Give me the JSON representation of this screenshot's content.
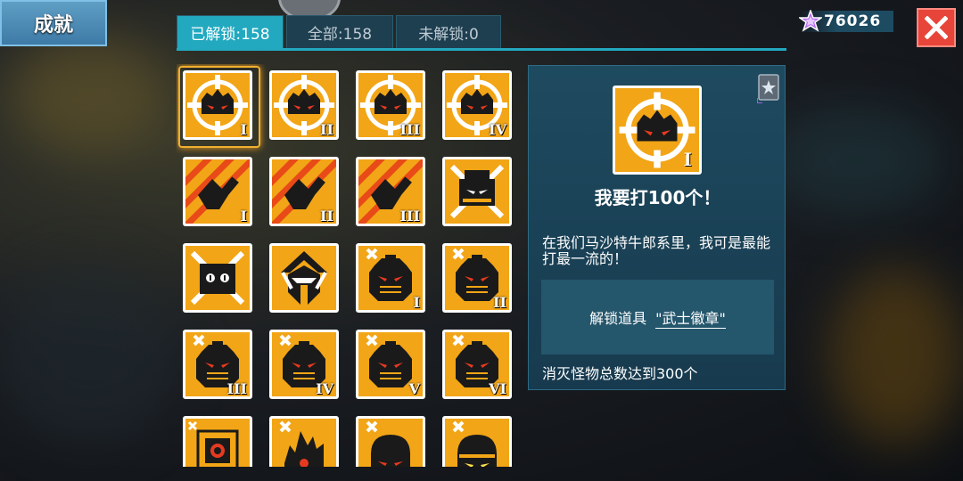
{
  "header": {
    "title": "成就"
  },
  "tabs": [
    {
      "label": "已解锁:158",
      "active": true
    },
    {
      "label": "全部:158",
      "active": false
    },
    {
      "label": "未解锁:0",
      "active": false
    }
  ],
  "currency": {
    "icon": "purple-star-icon",
    "value": "76026"
  },
  "close": {
    "icon": "close-icon"
  },
  "achievements": [
    {
      "icon": "target-monster-icon",
      "rank": "I",
      "selected": true
    },
    {
      "icon": "target-monster-icon",
      "rank": "II"
    },
    {
      "icon": "target-monster-icon",
      "rank": "III"
    },
    {
      "icon": "target-monster-icon",
      "rank": "IV"
    },
    {
      "icon": "fist-icon",
      "rank": "I"
    },
    {
      "icon": "fist-icon",
      "rank": "II"
    },
    {
      "icon": "fist-icon",
      "rank": "III"
    },
    {
      "icon": "crossed-robot-icon",
      "rank": ""
    },
    {
      "icon": "crossed-skull-icon",
      "rank": ""
    },
    {
      "icon": "hooded-figure-icon",
      "rank": ""
    },
    {
      "icon": "robot-head-icon",
      "rank": "I"
    },
    {
      "icon": "robot-head-icon",
      "rank": "II"
    },
    {
      "icon": "robot-head-icon",
      "rank": "III"
    },
    {
      "icon": "robot-head-icon",
      "rank": "IV"
    },
    {
      "icon": "robot-head-icon",
      "rank": "V"
    },
    {
      "icon": "robot-head-icon",
      "rank": "VI"
    },
    {
      "icon": "target-box-icon",
      "rank": ""
    },
    {
      "icon": "spiky-monster-icon",
      "rank": ""
    },
    {
      "icon": "helmet-red-eyes-icon",
      "rank": ""
    },
    {
      "icon": "helmet-yellow-eyes-icon",
      "rank": ""
    }
  ],
  "detail": {
    "icon": "target-monster-icon",
    "rank": "I",
    "rank_badge_icon": "rank-star-icon",
    "title": "我要打100个！",
    "description": "在我们马沙特牛郎系里，我可是最能打最一流的！",
    "reward_label": "解锁道具",
    "reward_item": "\"武士徽章\"",
    "condition": "消灭怪物总数达到300个"
  },
  "colors": {
    "badge_orange": "#f2a516",
    "tab_active": "#22a9c0",
    "close_red": "#e8453a"
  }
}
